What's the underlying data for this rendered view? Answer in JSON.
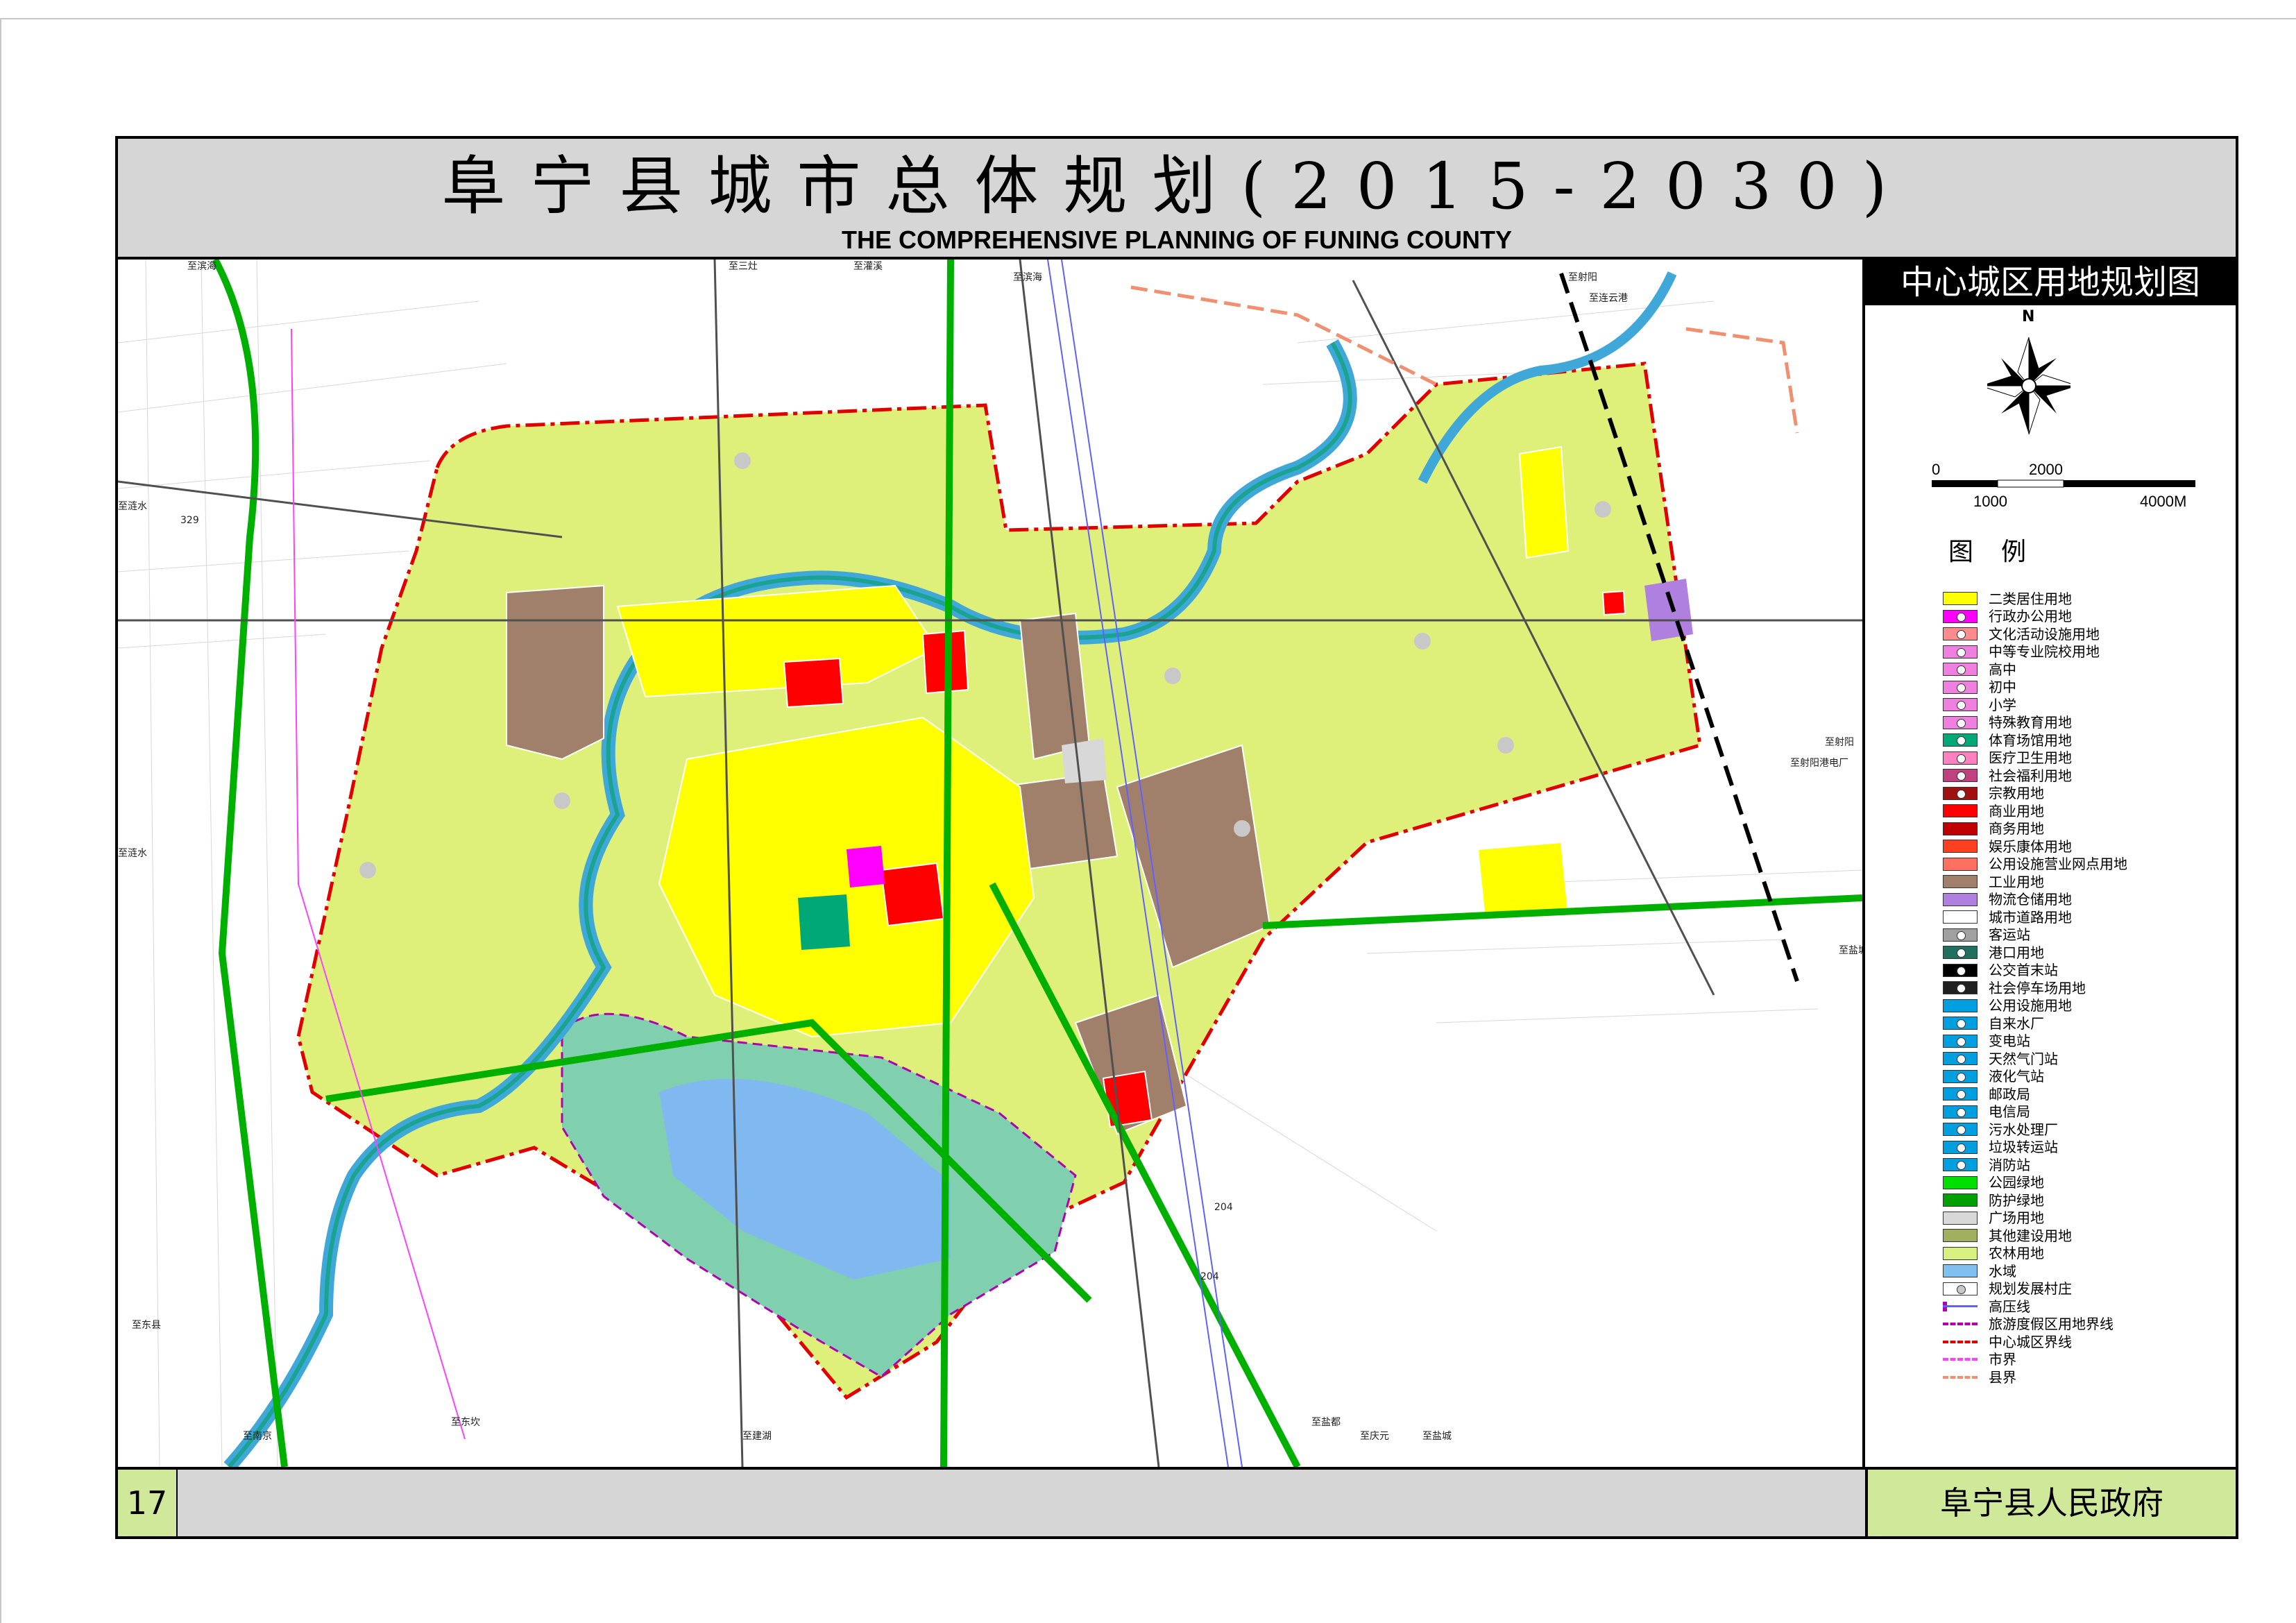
{
  "title": {
    "zh": "阜宁县城市总体规划(2015-2030)",
    "en": "THE COMPREHENSIVE PLANNING OF FUNING COUNTY"
  },
  "panel": {
    "title": "中心城区用地规划图",
    "north": "N",
    "scale": {
      "top_left": "0",
      "top_mid": "2000",
      "bottom_left": "1000",
      "bottom_right": "4000M"
    },
    "legend_heading": "图例"
  },
  "legend": [
    {
      "label": "二类居住用地",
      "color": "#ffff00",
      "mark": ""
    },
    {
      "label": "行政办公用地",
      "color": "#ff00ff",
      "mark": "dot"
    },
    {
      "label": "文化活动设施用地",
      "color": "#ff8c8c",
      "mark": "dot"
    },
    {
      "label": "中等专业院校用地",
      "color": "#f080e0",
      "mark": "dot"
    },
    {
      "label": "高中",
      "color": "#f080e0",
      "mark": "dot"
    },
    {
      "label": "初中",
      "color": "#f080e0",
      "mark": "dot"
    },
    {
      "label": "小学",
      "color": "#f080e0",
      "mark": "dot"
    },
    {
      "label": "特殊教育用地",
      "color": "#f080e0",
      "mark": "dot"
    },
    {
      "label": "体育场馆用地",
      "color": "#00a878",
      "mark": "dot"
    },
    {
      "label": "医疗卫生用地",
      "color": "#ff80c0",
      "mark": "dot"
    },
    {
      "label": "社会福利用地",
      "color": "#c04080",
      "mark": "dot"
    },
    {
      "label": "宗教用地",
      "color": "#a01010",
      "mark": "dot"
    },
    {
      "label": "商业用地",
      "color": "#ff0000",
      "mark": ""
    },
    {
      "label": "商务用地",
      "color": "#c00000",
      "mark": ""
    },
    {
      "label": "娱乐康体用地",
      "color": "#ff4020",
      "mark": ""
    },
    {
      "label": "公用设施营业网点用地",
      "color": "#ff7060",
      "mark": ""
    },
    {
      "label": "工业用地",
      "color": "#a0806a",
      "mark": ""
    },
    {
      "label": "物流仓储用地",
      "color": "#b080e0",
      "mark": ""
    },
    {
      "label": "城市道路用地",
      "color": "#ffffff",
      "mark": ""
    },
    {
      "label": "客运站",
      "color": "#a0a0a0",
      "mark": "dot"
    },
    {
      "label": "港口用地",
      "color": "#207060",
      "mark": "dot"
    },
    {
      "label": "公交首末站",
      "color": "#000000",
      "mark": "dot"
    },
    {
      "label": "社会停车场用地",
      "color": "#202020",
      "mark": "dot"
    },
    {
      "label": "公用设施用地",
      "color": "#00a0e0",
      "mark": ""
    },
    {
      "label": "自来水厂",
      "color": "#00a0e0",
      "mark": "dot"
    },
    {
      "label": "变电站",
      "color": "#00a0e0",
      "mark": "dot"
    },
    {
      "label": "天然气门站",
      "color": "#00a0e0",
      "mark": "dot"
    },
    {
      "label": "液化气站",
      "color": "#00a0e0",
      "mark": "dot"
    },
    {
      "label": "邮政局",
      "color": "#00a0e0",
      "mark": "dot"
    },
    {
      "label": "电信局",
      "color": "#00a0e0",
      "mark": "dot"
    },
    {
      "label": "污水处理厂",
      "color": "#00a0e0",
      "mark": "dot"
    },
    {
      "label": "垃圾转运站",
      "color": "#00a0e0",
      "mark": "dot"
    },
    {
      "label": "消防站",
      "color": "#00a0e0",
      "mark": "dot"
    },
    {
      "label": "公园绿地",
      "color": "#00e000",
      "mark": ""
    },
    {
      "label": "防护绿地",
      "color": "#00a000",
      "mark": ""
    },
    {
      "label": "广场用地",
      "color": "#d8d8d8",
      "mark": ""
    },
    {
      "label": "其他建设用地",
      "color": "#a0b060",
      "mark": ""
    },
    {
      "label": "农林用地",
      "color": "#d8f080",
      "mark": ""
    },
    {
      "label": "水域",
      "color": "#80c0f0",
      "mark": ""
    },
    {
      "label": "规划发展村庄",
      "color": "#ffffff",
      "mark": "grey-dot"
    },
    {
      "label": "高压线",
      "color": "#ffffff",
      "mark": "hv-line"
    },
    {
      "label": "旅游度假区用地界线",
      "color": "#ffffff",
      "mark": "dash-purple"
    },
    {
      "label": "中心城区界线",
      "color": "#ffffff",
      "mark": "dash-red"
    },
    {
      "label": "市界",
      "color": "#ffffff",
      "mark": "dash-pink"
    },
    {
      "label": "县界",
      "color": "#ffffff",
      "mark": "dash-salmon"
    }
  ],
  "footer": {
    "page_number": "17",
    "organization": "阜宁县人民政府"
  },
  "map_labels": [
    "至滨海",
    "至三灶",
    "至滨海",
    "至灌溪",
    "至射阳",
    "至连云港",
    "至涟水",
    "至涟水",
    "至射阳港电厂",
    "至射阳",
    "至盐城",
    "至建湖",
    "至东坎",
    "至庆元",
    "至盐城",
    "至盐都",
    "至东县",
    "至南京",
    "329",
    "204",
    "204"
  ],
  "colors": {
    "frame": "#000000",
    "title_bg": "#d6d6d6",
    "footer_accent": "#cfe89a",
    "agri": "#dff07a",
    "residential": "#ffff00",
    "industrial": "#a0806a",
    "commercial": "#ff0000",
    "water": "#80c0f0",
    "green": "#00c000",
    "boundary": "#e00000"
  }
}
